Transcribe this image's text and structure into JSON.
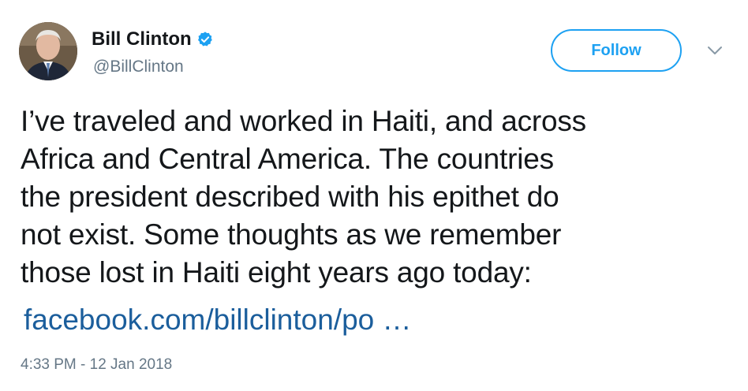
{
  "user": {
    "display_name": "Bill Clinton",
    "handle": "@BillClinton",
    "verified": true,
    "avatar_icon": "profile-photo"
  },
  "actions": {
    "follow_label": "Follow",
    "menu_icon": "chevron-down-icon"
  },
  "tweet": {
    "lines": [
      "I’ve traveled and worked in Haiti, and across",
      "Africa and Central America. The countries",
      "the president described with his epithet do",
      "not exist. Some thoughts as we remember",
      "those lost in Haiti eight years ago today:"
    ],
    "link_text": "facebook.com/billclinton/po …",
    "timestamp": "4:33 PM - 12 Jan 2018"
  },
  "colors": {
    "accent": "#1da1f2",
    "link": "#1b5e9c",
    "text": "#14171a",
    "muted": "#657786"
  }
}
